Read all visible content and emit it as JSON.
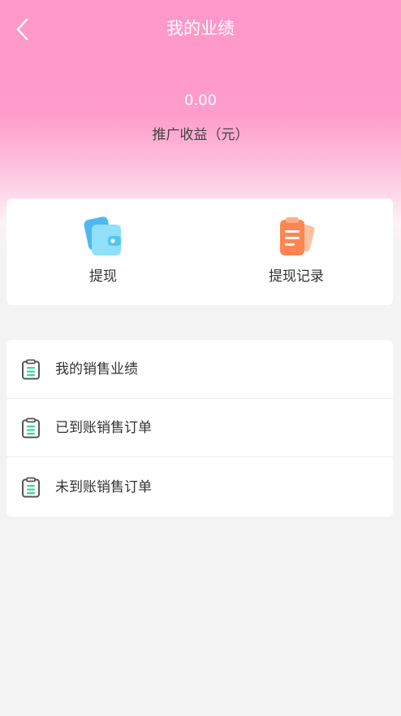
{
  "header": {
    "title": "我的业绩",
    "back_icon": "chevron-left-icon",
    "amount": "0.00",
    "amount_label": "推广收益（元）"
  },
  "actions": [
    {
      "label": "提现",
      "icon": "wallet-icon"
    },
    {
      "label": "提现记录",
      "icon": "clipboard-record-icon"
    }
  ],
  "list": [
    {
      "label": "我的销售业绩",
      "icon": "clipboard-icon"
    },
    {
      "label": "已到账销售订单",
      "icon": "clipboard-icon"
    },
    {
      "label": "未到账销售订单",
      "icon": "clipboard-icon"
    }
  ],
  "colors": {
    "header_pink": "#fe98c9",
    "page_bg": "#f3f3f3",
    "wallet_blue": "#5cc9f2",
    "record_orange": "#ff8a5c",
    "list_icon_green": "#3dd6a3"
  }
}
